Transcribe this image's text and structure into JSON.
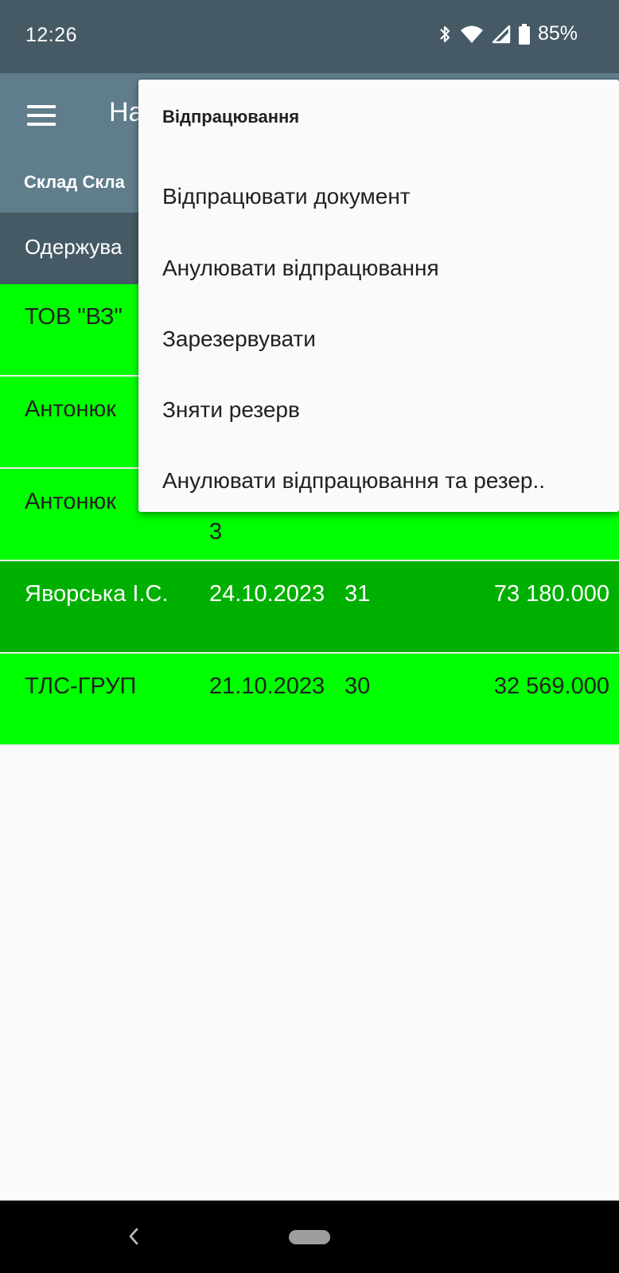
{
  "status_bar": {
    "time": "12:26",
    "battery": "85%",
    "icons": [
      "bluetooth-icon",
      "wifi-icon",
      "signal-icon",
      "battery-icon"
    ]
  },
  "app_bar": {
    "title": "На",
    "subtitle": "Склад Скла",
    "menu_icon": "hamburger-menu-icon"
  },
  "table": {
    "header_first": "Одержува",
    "rows": [
      {
        "name": "ТОВ \"ВЗ\"",
        "date": "",
        "number": "",
        "sum": "",
        "selected": false
      },
      {
        "name": "Антонюк",
        "date": "",
        "number": "",
        "sum": "",
        "selected": false
      },
      {
        "name": "Антонюк",
        "date": "3",
        "number": "",
        "sum": "",
        "selected": false
      },
      {
        "name": "Яворська І.С.",
        "date": "24.10.2023",
        "number": "31",
        "sum": "73 180.000",
        "selected": true
      },
      {
        "name": "ТЛС-ГРУП",
        "date": "21.10.2023",
        "number": "30",
        "sum": "32 569.000",
        "selected": false
      }
    ]
  },
  "popup_menu": {
    "header": "Відпрацювання",
    "items": [
      "Відпрацювати документ",
      "Анулювати відпрацювання",
      "Зарезервувати",
      "Зняти резерв",
      "Анулювати відпрацювання та резер.."
    ]
  },
  "colors": {
    "status_bar": "#455a64",
    "app_bar": "#607d8b",
    "row_green": "#00ff00",
    "row_selected": "#00b000"
  }
}
